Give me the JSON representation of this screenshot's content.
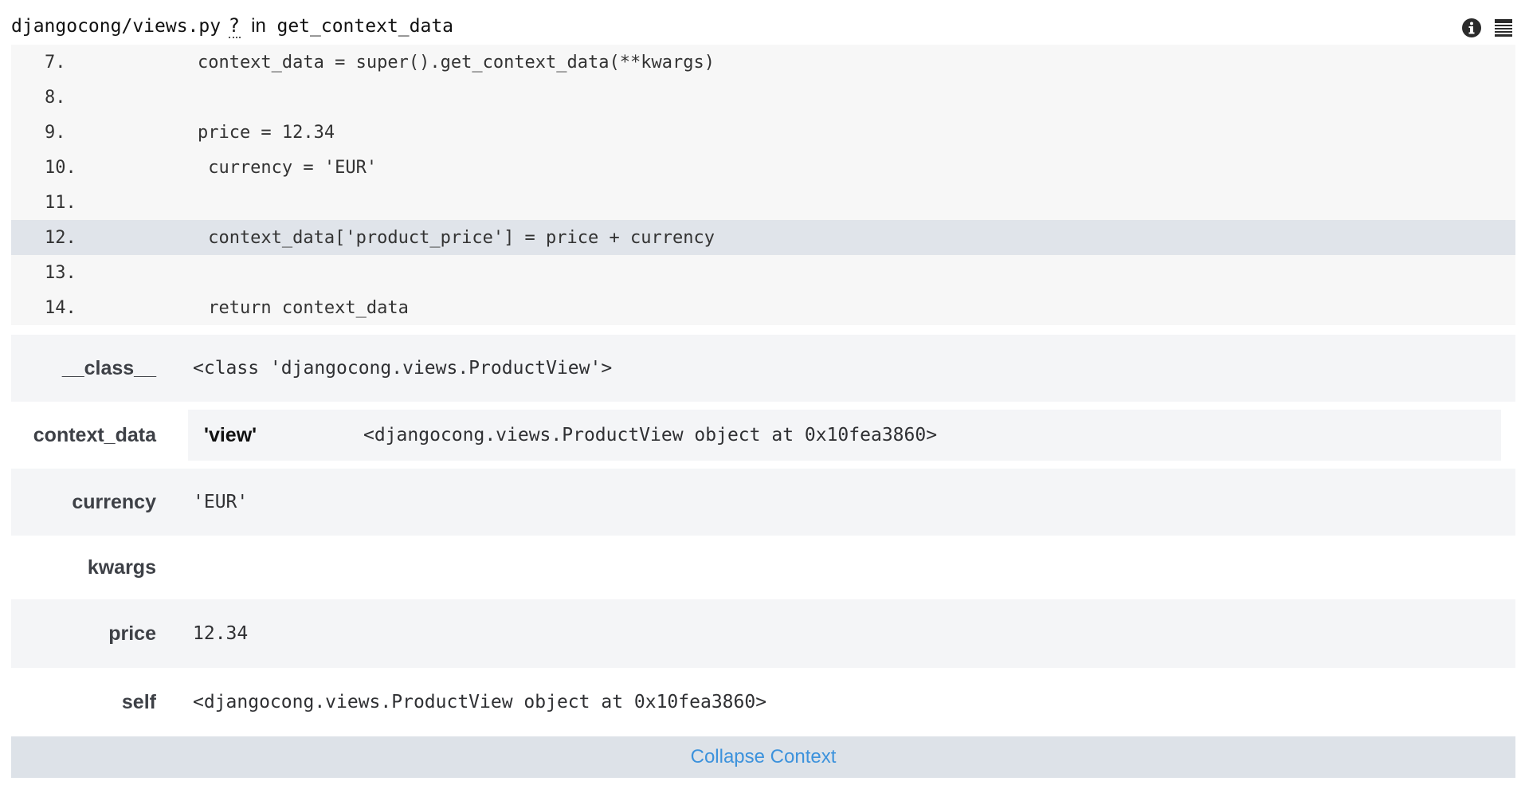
{
  "frame": {
    "filename": "djangocong/views.py",
    "help_mark": "?",
    "in_word": "in",
    "function": "get_context_data",
    "icons": [
      "info-icon",
      "stack-icon"
    ]
  },
  "code_lines": [
    {
      "no": "7.",
      "src": "        context_data = super().get_context_data(**kwargs)",
      "current": false
    },
    {
      "no": "8.",
      "src": "",
      "current": false
    },
    {
      "no": "9.",
      "src": "        price = 12.34",
      "current": false
    },
    {
      "no": "10.",
      "src": "         currency = 'EUR'",
      "current": false
    },
    {
      "no": "11.",
      "src": "",
      "current": false
    },
    {
      "no": "12.",
      "src": "         context_data['product_price'] = price + currency",
      "current": true
    },
    {
      "no": "13.",
      "src": "",
      "current": false
    },
    {
      "no": "14.",
      "src": "         return context_data",
      "current": false
    }
  ],
  "vars": {
    "class": {
      "key": "__class__",
      "value": "<class 'djangocong.views.ProductView'>"
    },
    "context_data": {
      "key": "context_data",
      "nested_key": "'view'",
      "nested_value": "<djangocong.views.ProductView object at 0x10fea3860>"
    },
    "currency": {
      "key": "currency",
      "value": "'EUR'"
    },
    "kwargs": {
      "key": "kwargs",
      "value": ""
    },
    "price": {
      "key": "price",
      "value": "12.34"
    },
    "self": {
      "key": "self",
      "value": "<djangocong.views.ProductView object at 0x10fea3860>"
    }
  },
  "collapse": {
    "label": "Collapse Context"
  },
  "colors": {
    "link": "#3c92dc",
    "current_line": "#e0e4ea",
    "code_bg": "#f7f7f7",
    "row_shade": "#f4f5f7",
    "collapse_bg": "#dde2e8"
  }
}
